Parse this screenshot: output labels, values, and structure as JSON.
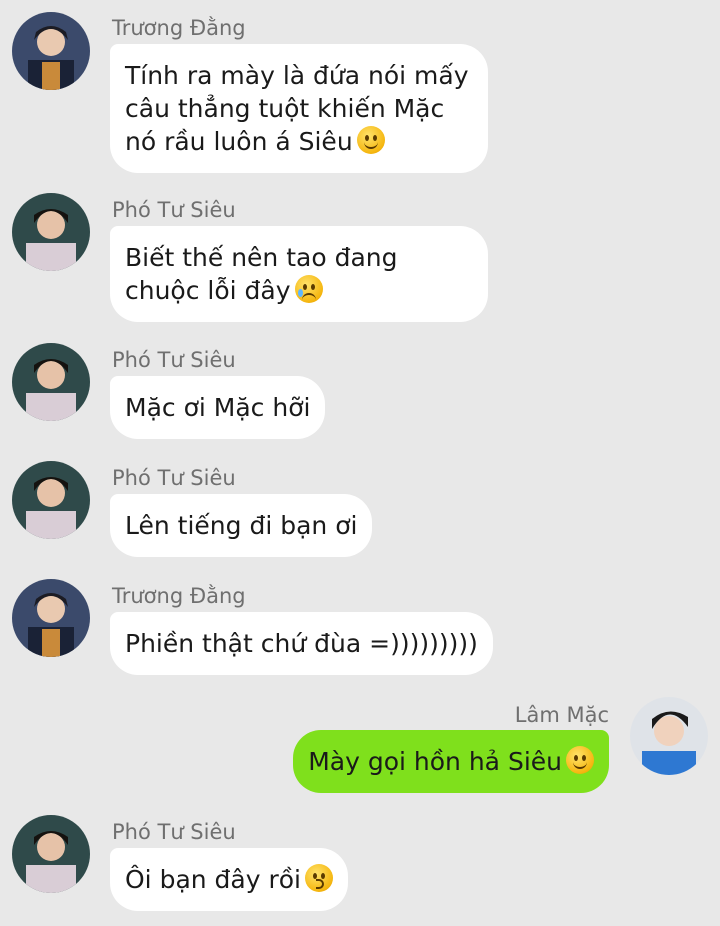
{
  "messages": [
    {
      "sender": "Trương Đằng",
      "text": "Tính ra mày là đứa nói mấy câu thẳng tuột khiến Mặc nó rầu luôn á Siêu",
      "emoji": "slightly-smiling-face-icon"
    },
    {
      "sender": "Phó Tư Siêu",
      "text": "Biết thế nên tao đang chuộc lỗi đây",
      "emoji": "crying-face-icon"
    },
    {
      "sender": "Phó Tư Siêu",
      "text": "Mặc ơi Mặc hỡi"
    },
    {
      "sender": "Phó Tư Siêu",
      "text": "Lên tiếng đi bạn ơi"
    },
    {
      "sender": "Trương Đằng",
      "text": "Phiền thật chứ đùa =)))))))))"
    },
    {
      "sender": "Lâm Mặc",
      "text": "Mày gọi hồn hả Siêu",
      "emoji": "slightly-smiling-face-icon",
      "outgoing": true
    },
    {
      "sender": "Phó Tư Siêu",
      "text": "Ôi bạn đây rồi",
      "emoji": "kissing-face-icon"
    }
  ],
  "colors": {
    "background": "#e8e8e8",
    "incoming_bubble": "#ffffff",
    "outgoing_bubble": "#7fe01c",
    "sender_name": "#6f6f6f"
  }
}
